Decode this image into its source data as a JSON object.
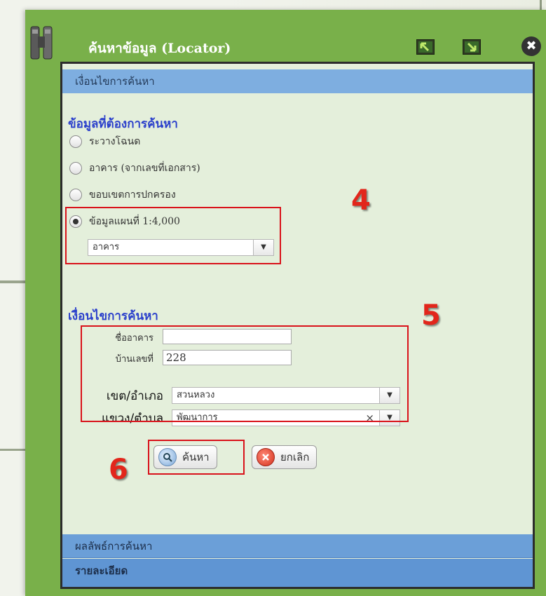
{
  "window": {
    "title": "ค้นหาข้อมูล (Locator)",
    "close_glyph": "✖",
    "icons": [
      "binoculars-icon",
      "restore-icon",
      "minimize-icon",
      "close-icon"
    ]
  },
  "search_conditions": {
    "header": "เงื่อนไขการค้นหา",
    "data_group_title": "ข้อมูลที่ต้องการค้นหา",
    "options": [
      {
        "label": "ระวางโฉนด",
        "checked": false
      },
      {
        "label": "อาคาร (จากเลขที่เอกสาร)",
        "checked": false
      },
      {
        "label": "ขอบเขตการปกครอง",
        "checked": false
      },
      {
        "label": "ข้อมูลแผนที่ 1:4,000",
        "checked": true
      }
    ],
    "layer_select": {
      "value": "อาคาร"
    }
  },
  "criteria": {
    "title": "เงื่อนไขการค้นหา",
    "building_name": {
      "label": "ชื่ออาคาร",
      "value": ""
    },
    "house_no": {
      "label": "บ้านเลขที่",
      "value": "228"
    },
    "district": {
      "label": "เขต/อำเภอ",
      "value": "สวนหลวง"
    },
    "subdistrict": {
      "label": "แขวง/ตำบล",
      "value": "พัฒนาการ",
      "clear_glyph": "×"
    }
  },
  "buttons": {
    "search_label": "ค้นหา",
    "cancel_label": "ยกเลิก"
  },
  "annotations": {
    "step4": "4",
    "step5": "5",
    "step6": "6"
  },
  "result_header": "ผลลัพธ์การค้นหา",
  "detail_header": "รายละเอียด",
  "colors": {
    "window_green": "#79b04a",
    "header_blue": "#7eaee0",
    "title_blue": "#2a3fcb",
    "annotation_red": "#d9121a"
  }
}
